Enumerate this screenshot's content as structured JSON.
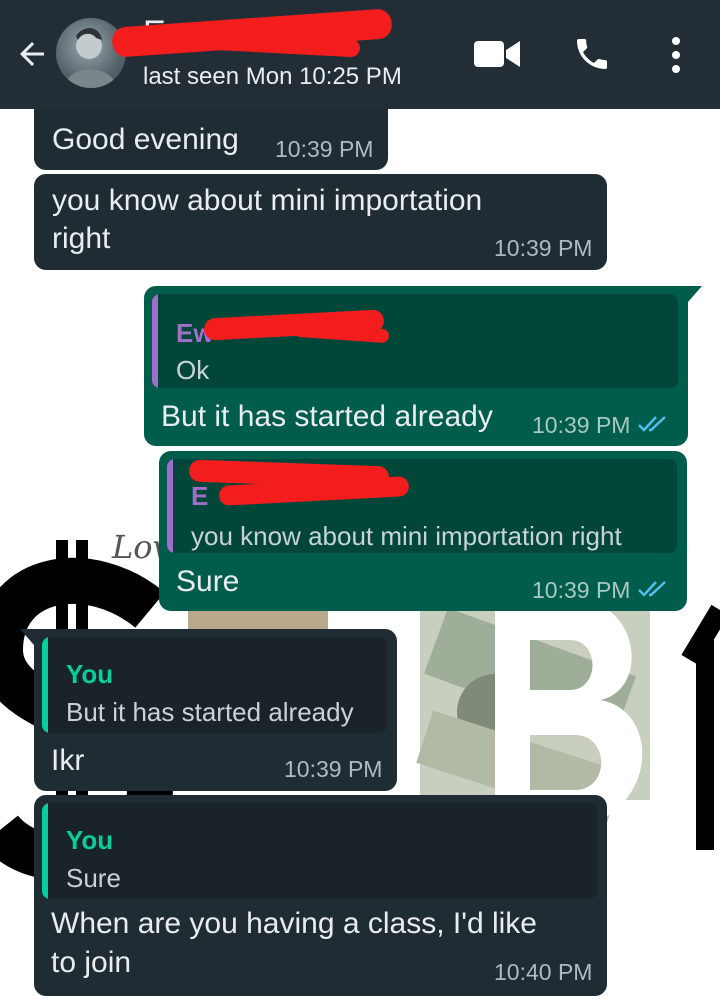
{
  "header": {
    "contact_name": "E",
    "last_seen": "last seen Mon 10:25 PM",
    "back_icon": "arrow-left-icon",
    "video_icon": "videocam-icon",
    "call_icon": "phone-icon",
    "menu_icon": "more-vert-icon"
  },
  "colors": {
    "header_bg": "#232d36",
    "incoming_bubble": "#202c33",
    "outgoing_bubble": "#005c4b",
    "read_ticks": "#53bdeb",
    "quote_you": "#06cf9c",
    "quote_other": "#a070c8",
    "redaction": "#f31d1d"
  },
  "messages": [
    {
      "direction": "in",
      "text": "Good evening",
      "time": "10:39 PM"
    },
    {
      "direction": "in",
      "text_line1": "you know about mini importation",
      "text_line2": "right",
      "time": "10:39 PM"
    },
    {
      "direction": "out",
      "quote_author": "Ew",
      "quote_text": "Ok",
      "text": "But it has started already",
      "time": "10:39 PM",
      "status": "read"
    },
    {
      "direction": "out",
      "quote_author": "E",
      "quote_text": "you know about mini importation right",
      "text": "Sure",
      "time": "10:39 PM",
      "status": "read"
    },
    {
      "direction": "in",
      "quote_author": "You",
      "quote_text": "But it has started already",
      "text": "Ikr",
      "time": "10:39 PM"
    },
    {
      "direction": "in",
      "quote_author": "You",
      "quote_text": "Sure",
      "text_line1": "When are you having a class, I'd like",
      "text_line2": "to join",
      "time": "10:40 PM"
    }
  ],
  "wallpaper": {
    "handwriting": "Lov"
  }
}
